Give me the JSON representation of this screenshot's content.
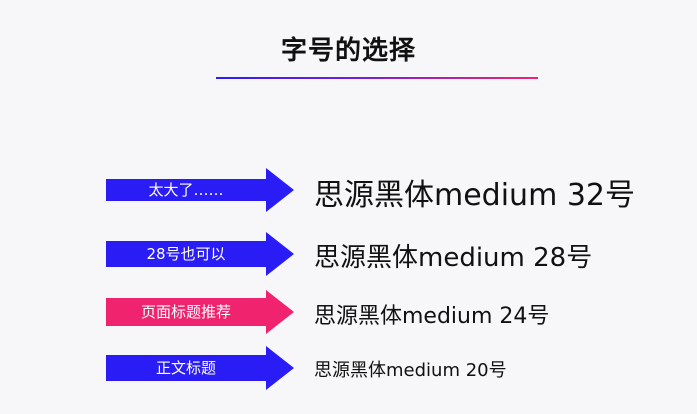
{
  "title": "字号的选择",
  "colors": {
    "blue": "#2a1cf5",
    "pink": "#f0246e",
    "underline_start": "#2a1cff",
    "underline_end": "#f0246e"
  },
  "rows": [
    {
      "label": "太大了……",
      "sample": "思源黑体medium 32号",
      "color": "#2a1cf5"
    },
    {
      "label": "28号也可以",
      "sample": "思源黑体medium 28号",
      "color": "#2a1cf5"
    },
    {
      "label": "页面标题推荐",
      "sample": "思源黑体medium 24号",
      "color": "#f0246e"
    },
    {
      "label": "正文标题",
      "sample": "思源黑体medium 20号",
      "color": "#2a1cf5"
    }
  ]
}
